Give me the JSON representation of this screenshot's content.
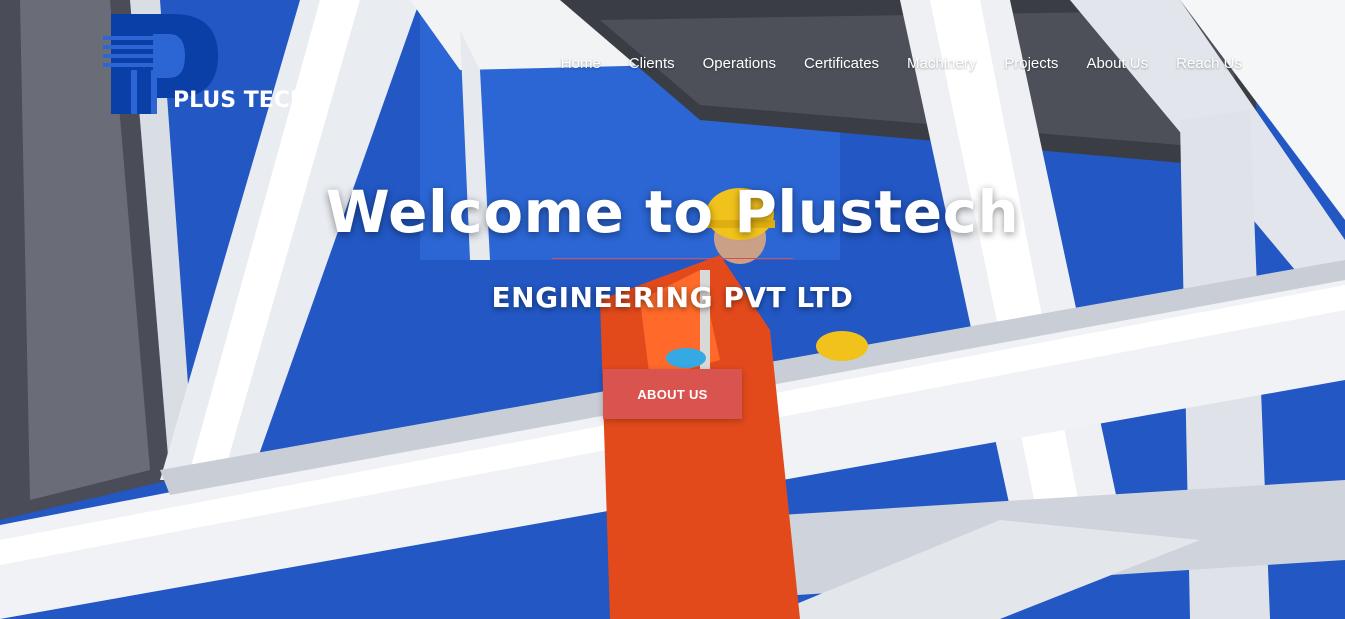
{
  "brand": {
    "name": "PLUS TECH",
    "logo_color": "#0b3fa8"
  },
  "nav": {
    "items": [
      {
        "label": "Home"
      },
      {
        "label": "Clients"
      },
      {
        "label": "Operations"
      },
      {
        "label": "Certificates"
      },
      {
        "label": "Machinery"
      },
      {
        "label": "Projects"
      },
      {
        "label": "About Us"
      },
      {
        "label": "Reach Us"
      }
    ]
  },
  "hero": {
    "title": "Welcome to Plustech",
    "subtitle": "ENGINEERING PVT LTD",
    "cta_label": "ABOUT US",
    "accent_color": "#d9534f"
  }
}
